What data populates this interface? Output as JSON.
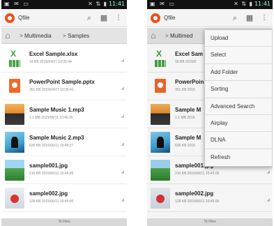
{
  "statusbar": {
    "left_icons": "▣ ✉ ▭",
    "right_icons": "✕ ⇅ ▮",
    "time": "11:41"
  },
  "app": {
    "title": "Qfile"
  },
  "breadcrumb": {
    "folder": "Multimedia",
    "subfolder": "Samples",
    "folder_truncated": "Multimed"
  },
  "files": [
    {
      "name": "Excel Sample.xlsx",
      "meta": "16 KB  2015/04/27 10:05:44",
      "thumb": "excel-icon"
    },
    {
      "name": "PowerPoint Sample.pptx",
      "meta": "351 KB  2015/04/27 10:05:41",
      "thumb": "powerpoint-icon"
    },
    {
      "name": "Sample Music 1.mp3",
      "meta": "1.1 MB  2015/06/11 10:45:26",
      "thumb": "music-thumbnail"
    },
    {
      "name": "Sample Music 2.mp3",
      "meta": "636 KB  2015/06/11 10:45:27",
      "thumb": "music-thumbnail"
    },
    {
      "name": "sample001.jpg",
      "meta": "210 KB  2015/06/11 10:45:05",
      "thumb": "photo-thumbnail"
    },
    {
      "name": "sample002.jpg",
      "meta": "128 KB  2015/06/11 10:45:05",
      "thumb": "photo-thumbnail"
    }
  ],
  "files_right": [
    {
      "name": "Excel Sam",
      "meta": "16 KB  2015/0"
    },
    {
      "name": "PowerPoin",
      "meta": "351 KB  2015"
    },
    {
      "name": "Sample M",
      "meta": "1.1 MB  2015"
    },
    {
      "name": "Sample M",
      "meta": "636 KB  2015"
    },
    {
      "name": "sample001.jpg",
      "meta": "210 KB  2015/06/11 10:45:05"
    },
    {
      "name": "sample002.jpg",
      "meta": "128 KB  2015/06/11 10:45:05"
    }
  ],
  "menu": {
    "items": [
      "Upload",
      "Select",
      "Add Folder",
      "Sorting",
      "Advanced Search",
      "Airplay",
      "DLNA",
      "Refresh"
    ]
  },
  "bottombar": {
    "label": "Tit Files"
  },
  "colors": {
    "accent": "#e8531d",
    "actionbar": "#f4f4f4",
    "pathbar": "#e4e4e4"
  }
}
